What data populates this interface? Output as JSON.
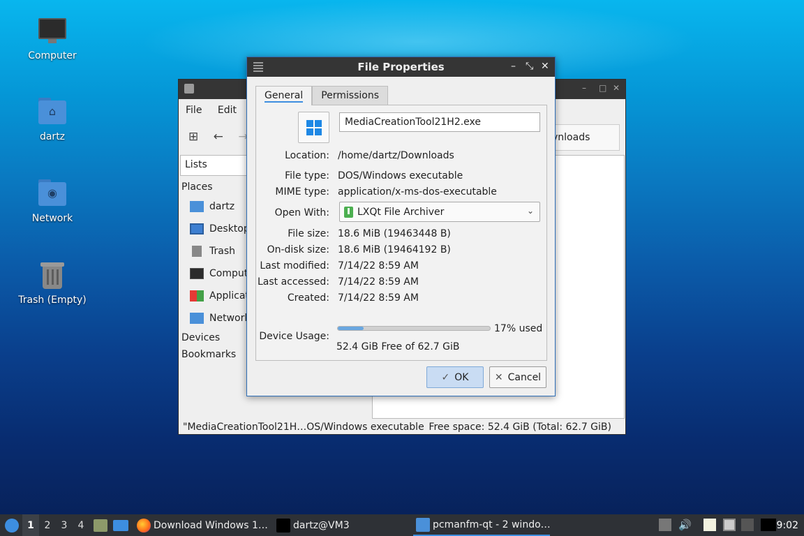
{
  "desktop": {
    "icons": [
      {
        "label": "Computer"
      },
      {
        "label": "dartz"
      },
      {
        "label": "Network"
      },
      {
        "label": "Trash (Empty)"
      }
    ]
  },
  "file_manager": {
    "menu": [
      "File",
      "Edit"
    ],
    "tab_partial": "vnloads",
    "side_mode": "Lists",
    "places_header": "Places",
    "places": [
      {
        "label": "dartz",
        "icon": "home-folder-icon"
      },
      {
        "label": "Desktop",
        "icon": "desktop-icon"
      },
      {
        "label": "Trash",
        "icon": "trash-icon"
      },
      {
        "label": "Computer",
        "icon": "computer-icon"
      },
      {
        "label": "Applications",
        "icon": "applications-icon"
      },
      {
        "label": "Network",
        "icon": "network-icon"
      }
    ],
    "devices_header": "Devices",
    "bookmarks_header": "Bookmarks",
    "status_left": "\"MediaCreationTool21H…OS/Windows executable",
    "status_right": "Free space: 52.4 GiB (Total: 62.7 GiB)"
  },
  "dialog": {
    "title": "File Properties",
    "tabs": [
      "General",
      "Permissions"
    ],
    "file_name": "MediaCreationTool21H2.exe",
    "fields": {
      "location_label": "Location:",
      "location": "/home/dartz/Downloads",
      "file_type_label": "File type:",
      "file_type": "DOS/Windows executable",
      "mime_label": "MIME type:",
      "mime": "application/x-ms-dos-executable",
      "open_with_label": "Open With:",
      "open_with": "LXQt File Archiver",
      "file_size_label": "File size:",
      "file_size": "18.6 MiB (19463448 B)",
      "disk_size_label": "On-disk size:",
      "disk_size": "18.6 MiB (19464192 B)",
      "modified_label": "Last modified:",
      "modified": "7/14/22 8:59 AM",
      "accessed_label": "Last accessed:",
      "accessed": "7/14/22 8:59 AM",
      "created_label": "Created:",
      "created": "7/14/22 8:59 AM",
      "device_usage_label": "Device Usage:",
      "device_usage_percent": "17% used",
      "device_usage_fraction": 0.17,
      "device_free": "52.4 GiB Free of 62.7 GiB"
    },
    "ok_label": "OK",
    "cancel_label": "Cancel"
  },
  "taskbar": {
    "desktops": [
      "1",
      "2",
      "3",
      "4"
    ],
    "tasks": [
      {
        "label": "Download Windows 1…"
      },
      {
        "label": "dartz@VM3"
      },
      {
        "label": "pcmanfm-qt - 2 windo…"
      }
    ],
    "clock": "9:02"
  }
}
